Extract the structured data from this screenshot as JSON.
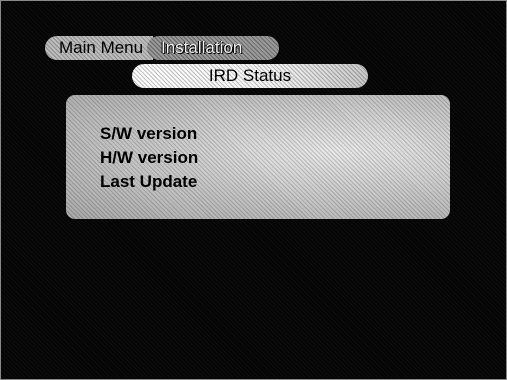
{
  "breadcrumb": {
    "main": "Main Menu",
    "section": "Installation"
  },
  "title": "IRD Status",
  "info": {
    "items": [
      "S/W version",
      "H/W version",
      "Last Update"
    ]
  }
}
